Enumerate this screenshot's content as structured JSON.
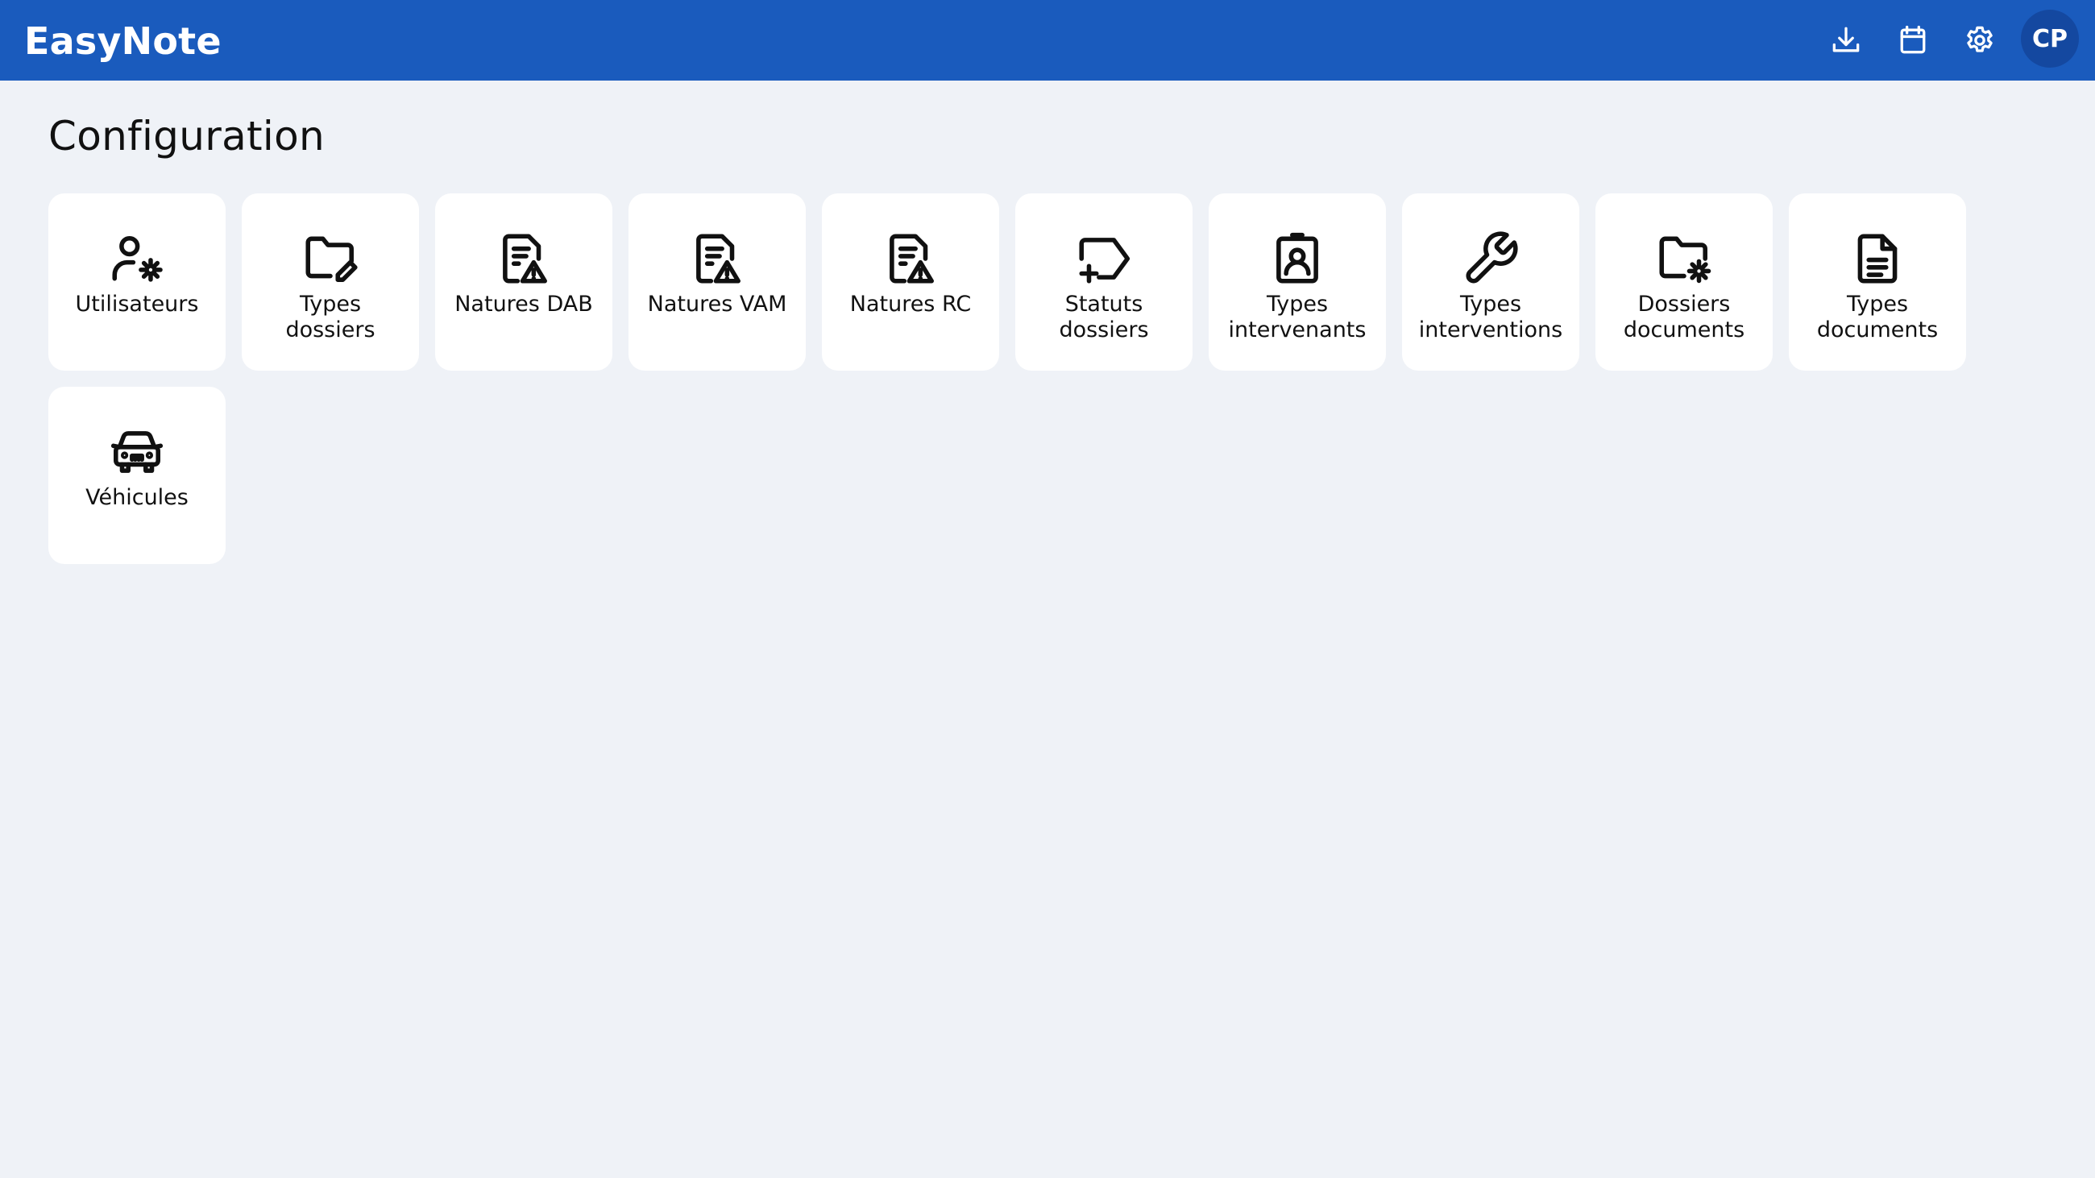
{
  "app": {
    "title": "EasyNote"
  },
  "header": {
    "icons": [
      "download-icon",
      "calendar-icon",
      "settings-icon"
    ],
    "user_initials": "CP"
  },
  "main": {
    "title": "Configuration",
    "tiles": [
      {
        "label": "Utilisateurs",
        "icon": "user-settings-icon"
      },
      {
        "label": "Types\ndossiers",
        "icon": "folder-edit-icon"
      },
      {
        "label": "Natures DAB",
        "icon": "document-warning-icon"
      },
      {
        "label": "Natures VAM",
        "icon": "document-warning-icon"
      },
      {
        "label": "Natures RC",
        "icon": "document-warning-icon"
      },
      {
        "label": "Statuts\ndossiers",
        "icon": "tag-add-icon"
      },
      {
        "label": "Types\nintervenants",
        "icon": "contact-badge-icon"
      },
      {
        "label": "Types\ninterventions",
        "icon": "wrench-icon"
      },
      {
        "label": "Dossiers\ndocuments",
        "icon": "folder-settings-icon"
      },
      {
        "label": "Types\ndocuments",
        "icon": "document-icon"
      },
      {
        "label": "Véhicules",
        "icon": "car-icon"
      }
    ]
  },
  "colors": {
    "header": "#1a5bbd",
    "background": "#eff2f7",
    "tile": "#ffffff",
    "avatar": "#1448a0"
  }
}
